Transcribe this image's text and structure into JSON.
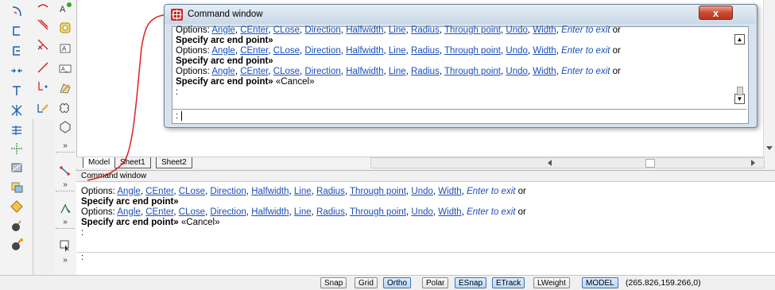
{
  "float_window": {
    "title": "Command window",
    "close_label": "x",
    "history": [
      {
        "kind": "options"
      },
      {
        "kind": "prompt",
        "text": "Specify arc end point»",
        "suffix": ""
      },
      {
        "kind": "options"
      },
      {
        "kind": "prompt",
        "text": "Specify arc end point»",
        "suffix": ""
      },
      {
        "kind": "options"
      },
      {
        "kind": "prompt",
        "text": "Specify arc end point»",
        "suffix": " «Cancel»"
      },
      {
        "kind": "plain",
        "text": ":"
      }
    ],
    "input_prompt": ":"
  },
  "options_line": {
    "prefix": "Options: ",
    "options": [
      "Angle",
      "CEnter",
      "CLose",
      "Direction",
      "Halfwidth",
      "Line",
      "Radius",
      "Through point",
      "Undo",
      "Width"
    ],
    "separator": ", ",
    "exit_text": "Enter to exit",
    "exit_suffix": " or"
  },
  "tabs": [
    "Model",
    "Sheet1",
    "Sheet2"
  ],
  "dock": {
    "title": "Command window",
    "history": [
      {
        "kind": "options"
      },
      {
        "kind": "prompt",
        "text": "Specify arc end point»",
        "suffix": ""
      },
      {
        "kind": "options"
      },
      {
        "kind": "prompt",
        "text": "Specify arc end point»",
        "suffix": " «Cancel»"
      },
      {
        "kind": "plain",
        "text": ":"
      }
    ],
    "input_prompt": ":"
  },
  "status_bar": {
    "buttons": [
      {
        "label": "Snap",
        "on": false
      },
      {
        "label": "Grid",
        "on": false
      },
      {
        "label": "Ortho",
        "on": true
      },
      {
        "label": "Polar",
        "on": false
      },
      {
        "label": "ESnap",
        "on": true
      },
      {
        "label": "ETrack",
        "on": true
      },
      {
        "label": "LWeight",
        "on": false
      },
      {
        "label": "MODEL",
        "on": true
      }
    ],
    "coordinates": "(265.826,159.266,0)"
  },
  "colors": {
    "link": "#1a4dbb",
    "toggle_on": "#b9d8f6",
    "callout_line": "#e02020",
    "close_button": "#c94a33"
  },
  "toolbar_icons": {
    "column1": [
      "arc-tool-icon",
      "circle-3p-icon",
      "arc-3p-icon",
      "dimension-icon",
      "vertical-line-icon",
      "explode-icon",
      "hatch-icon",
      "polar-array-icon",
      "fill-icon",
      "layer-icon",
      "properties-icon",
      "bomb-icon",
      "bomb-explode-icon"
    ],
    "column2": [
      "spline-icon",
      "construction-line-icon",
      "erase-icon",
      "line-icon",
      "polyline-point-icon",
      "polyline-edit-icon"
    ],
    "column3": [
      "text-style-icon",
      "region-icon",
      "text-icon",
      "text-box-icon",
      "boundary-icon",
      "cloud-icon",
      "polygon-icon",
      "more-tools-icon",
      "dimension-edit-icon",
      "more-tools-icon",
      "stretch-icon",
      "more-tools-icon",
      "select-icon",
      "more-tools-icon"
    ]
  }
}
